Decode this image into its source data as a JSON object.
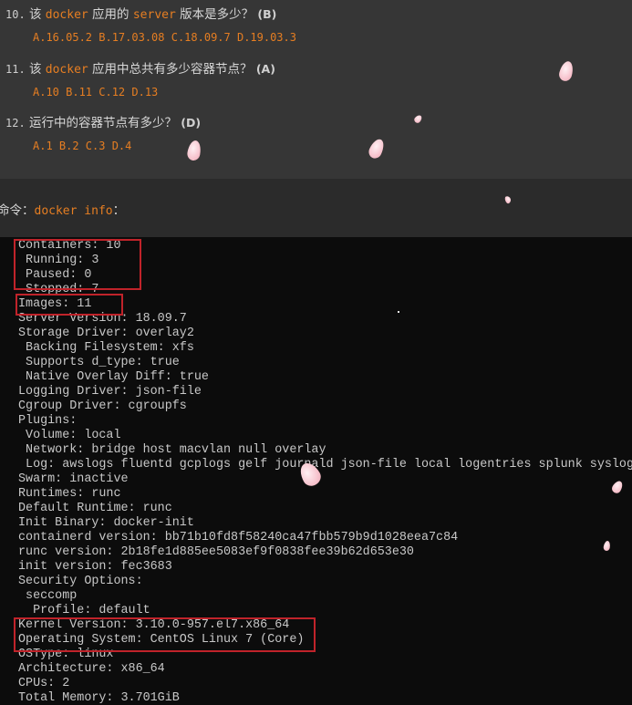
{
  "questions": [
    {
      "num": "10.",
      "prefix": " 该 ",
      "code1": "docker",
      "middle": " 应用的 ",
      "code2": "server",
      "suffix": " 版本是多少？ ",
      "answer": "(B)",
      "options": "A.16.05.2 B.17.03.08 C.18.09.7 D.19.03.3"
    },
    {
      "num": "11.",
      "prefix": " 该 ",
      "code1": "docker",
      "middle": " 应用中总共有多少容器节点？ ",
      "answer": "(A)",
      "options": "A.10 B.11 C.12 D.13"
    },
    {
      "num": "12.",
      "prefix": " 运行中的容器节点有多少？ ",
      "answer": "(D)",
      "options": "A.1 B.2 C.3 D.4"
    }
  ],
  "command": {
    "label": "命令：",
    "code": "docker info",
    "suffix": "："
  },
  "terminal_lines": [
    "Containers: 10",
    " Running: 3",
    " Paused: 0",
    " Stopped: 7",
    "Images: 11",
    "Server Version: 18.09.7",
    "Storage Driver: overlay2",
    " Backing Filesystem: xfs",
    " Supports d_type: true",
    " Native Overlay Diff: true",
    "Logging Driver: json-file",
    "Cgroup Driver: cgroupfs",
    "Plugins:",
    " Volume: local",
    " Network: bridge host macvlan null overlay",
    " Log: awslogs fluentd gcplogs gelf journald json-file local logentries splunk syslog",
    "Swarm: inactive",
    "Runtimes: runc",
    "Default Runtime: runc",
    "Init Binary: docker-init",
    "containerd version: bb71b10fd8f58240ca47fbb579b9d1028eea7c84",
    "runc version: 2b18fe1d885ee5083ef9f0838fee39b62d653e30",
    "init version: fec3683",
    "Security Options:",
    " seccomp",
    "  Profile: default",
    "Kernel Version: 3.10.0-957.el7.x86_64",
    "Operating System: CentOS Linux 7 (Core)",
    "OSType: linux",
    "Architecture: x86_64",
    "CPUs: 2",
    "Total Memory: 3.701GiB"
  ],
  "colors": {
    "accent_code": "#e67e22",
    "highlight_box": "#c0232a",
    "terminal_bg": "#0c0c0c",
    "panel_bg": "#363636"
  }
}
